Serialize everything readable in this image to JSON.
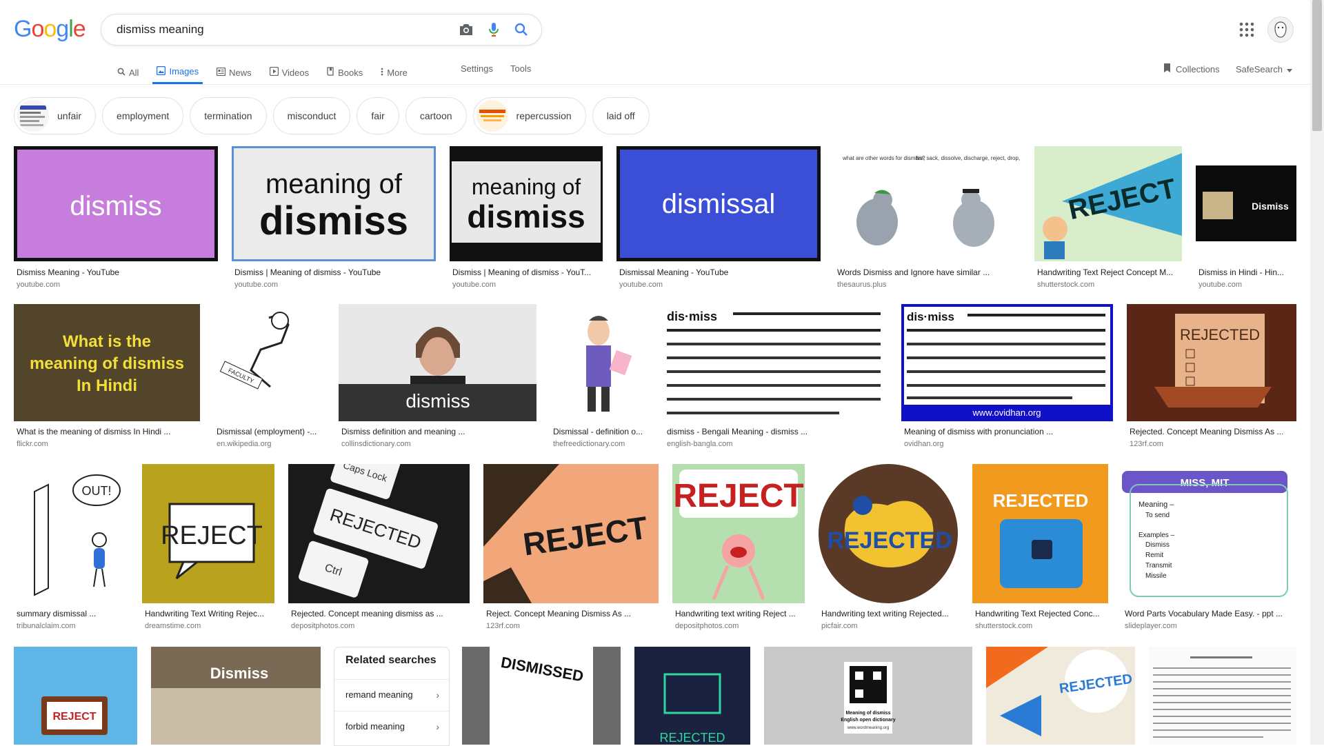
{
  "header": {
    "logo_letters": [
      {
        "ch": "G",
        "color": "#4285F4"
      },
      {
        "ch": "o",
        "color": "#EA4335"
      },
      {
        "ch": "o",
        "color": "#FBBC05"
      },
      {
        "ch": "g",
        "color": "#4285F4"
      },
      {
        "ch": "l",
        "color": "#34A853"
      },
      {
        "ch": "e",
        "color": "#EA4335"
      }
    ],
    "search_value": "dismiss meaning",
    "icons": [
      "camera-icon",
      "microphone-icon",
      "search-icon",
      "apps-grid-icon",
      "avatar"
    ]
  },
  "tabs": [
    {
      "label": "All",
      "icon": "search-icon",
      "active": false
    },
    {
      "label": "Images",
      "icon": "image-icon",
      "active": true
    },
    {
      "label": "News",
      "icon": "news-icon",
      "active": false
    },
    {
      "label": "Videos",
      "icon": "video-icon",
      "active": false
    },
    {
      "label": "Books",
      "icon": "book-icon",
      "active": false
    },
    {
      "label": "More",
      "icon": "more-vert-icon",
      "active": false
    }
  ],
  "tools": {
    "settings": "Settings",
    "tools": "Tools"
  },
  "right_tools": {
    "collections": "Collections",
    "safesearch": "SafeSearch"
  },
  "chips": [
    "unfair",
    "employment",
    "termination",
    "misconduct",
    "fair",
    "cartoon",
    "repercussion",
    "laid off"
  ],
  "results": {
    "row1": [
      {
        "title": "Dismiss Meaning - YouTube",
        "source": "youtube.com",
        "img_text": "dismiss"
      },
      {
        "title": "Dismiss | Meaning of dismiss - YouTube",
        "source": "youtube.com",
        "img_text_1": "meaning of",
        "img_text_2": "dismiss"
      },
      {
        "title": "Dismiss | Meaning of dismiss - YouT...",
        "source": "youtube.com",
        "img_text_1": "meaning of",
        "img_text_2": "dismiss"
      },
      {
        "title": "Dismissal Meaning - YouTube",
        "source": "youtube.com",
        "img_text": "dismissal"
      },
      {
        "title": "Words Dismiss and Ignore have similar ...",
        "source": "thesaurus.plus",
        "img_text_1": "what are other words for dismiss?",
        "img_text_2": "fire, sack, dissolve, discharge, reject, drop, banish, disregard, throw out, expel"
      },
      {
        "title": "Handwriting Text Reject Concept M...",
        "source": "shutterstock.com",
        "img_text": "REJECT"
      },
      {
        "title": "Dismiss in Hindi - Hin...",
        "source": "youtube.com",
        "img_text": "Dismiss"
      }
    ],
    "row2": [
      {
        "title": "What is the meaning of dismiss In Hindi ...",
        "source": "flickr.com",
        "img_text_1": "What is the",
        "img_text_2": "meaning of dismiss",
        "img_text_3": "In Hindi"
      },
      {
        "title": "Dismissal (employment) -...",
        "source": "en.wikipedia.org",
        "img_text": "FACULTY"
      },
      {
        "title": "Dismiss definition and meaning ...",
        "source": "collinsdictionary.com",
        "img_text": "dismiss"
      },
      {
        "title": "Dismissal - definition o...",
        "source": "thefreedictionary.com"
      },
      {
        "title": "dismiss - Bengali Meaning - dismiss ...",
        "source": "english-bangla.com",
        "img_text": "dis·miss"
      },
      {
        "title": "Meaning of dismiss with pronunciation ...",
        "source": "ovidhan.org",
        "img_text": "dis·miss",
        "img_footer": "www.ovidhan.org"
      },
      {
        "title": "Rejected. Concept Meaning Dismiss As ...",
        "source": "123rf.com",
        "img_text": "REJECTED"
      }
    ],
    "row3": [
      {
        "title": "summary dismissal ...",
        "source": "tribunalclaim.com",
        "img_text": "OUT!"
      },
      {
        "title": "Handwriting Text Writing Rejec...",
        "source": "dreamstime.com",
        "img_text": "REJECT"
      },
      {
        "title": "Rejected. Concept meaning dismiss as ...",
        "source": "depositphotos.com",
        "img_text_1": "Caps Lock",
        "img_text_2": "REJECTED",
        "img_text_3": "Ctrl"
      },
      {
        "title": "Reject. Concept Meaning Dismiss As ...",
        "source": "123rf.com",
        "img_text": "REJECT"
      },
      {
        "title": "Handwriting text writing Reject ...",
        "source": "depositphotos.com",
        "img_text": "REJECT"
      },
      {
        "title": "Handwriting text writing Rejected...",
        "source": "picfair.com",
        "img_text": "REJECTED"
      },
      {
        "title": "Handwriting Text Rejected Conc...",
        "source": "shutterstock.com",
        "img_text": "REJECTED"
      },
      {
        "title": "Word Parts Vocabulary Made Easy. - ppt ...",
        "source": "slideplayer.com",
        "img_header": "MISS, MIT",
        "img_lines": [
          "Meaning –",
          "To send",
          "Examples –",
          "Dismiss",
          "Remit",
          "Transmit",
          "Missile"
        ]
      }
    ],
    "row4": [
      {
        "img_text": "REJECT"
      },
      {
        "img_text": "Dismiss"
      },
      {
        "img_text": "DISMISSED"
      },
      {
        "img_text": "REJECTED"
      },
      {
        "img_text_1": "Meaning of dismiss",
        "img_text_2": "English open dictionary",
        "img_text_3": "www.wordmeaning.org"
      },
      {
        "img_text": "REJECTED"
      },
      {}
    ]
  },
  "related": {
    "title": "Related searches",
    "items": [
      "remand meaning",
      "forbid meaning"
    ]
  }
}
